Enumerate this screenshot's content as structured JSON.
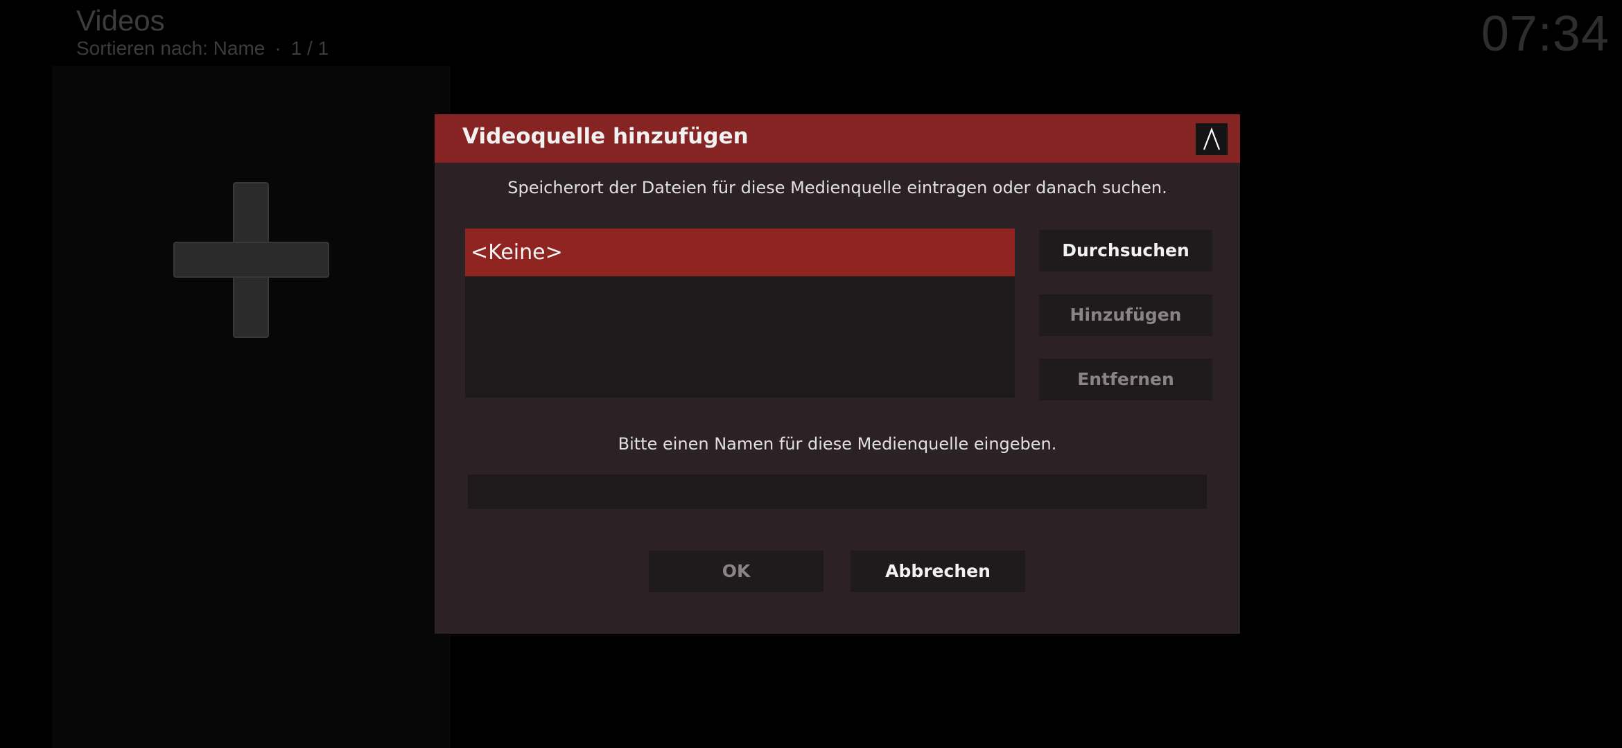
{
  "header": {
    "title": "Videos",
    "sort_label": "Sortieren nach: Name",
    "separator": "·",
    "page_count": "1 / 1",
    "clock": "07:34"
  },
  "background": {
    "add_tile_icon": "plus-icon"
  },
  "dialog": {
    "title": "Videoquelle hinzufügen",
    "close_icon": "close-icon",
    "path_instruction": "Speicherort der Dateien für diese Medienquelle eintragen oder danach suchen.",
    "paths": [
      {
        "label": "<Keine>",
        "selected": true
      }
    ],
    "buttons": {
      "browse": "Durchsuchen",
      "add": "Hinzufügen",
      "remove": "Entfernen"
    },
    "name_instruction": "Bitte einen Namen für diese Medienquelle eingeben.",
    "name_value": "",
    "footer": {
      "ok": "OK",
      "cancel": "Abbrechen"
    }
  },
  "colors": {
    "accent_red": "#862424",
    "selected_item_red": "#8f2420",
    "dialog_bg": "#2c2225",
    "button_bg": "#1f1a1c",
    "disabled_text": "#8a8486"
  }
}
